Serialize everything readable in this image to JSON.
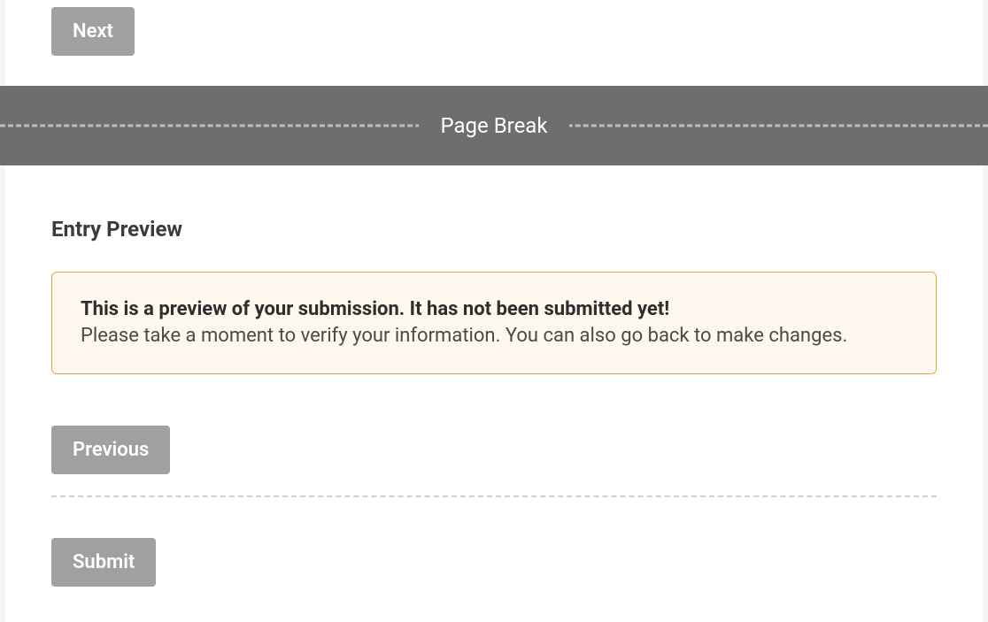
{
  "topSection": {
    "nextButton": "Next"
  },
  "pageBreak": {
    "label": "Page Break"
  },
  "preview": {
    "heading": "Entry Preview",
    "alertStrong": "This is a preview of your submission. It has not been submitted yet!",
    "alertText": "Please take a moment to verify your information. You can also go back to make changes.",
    "previousButton": "Previous",
    "submitButton": "Submit"
  }
}
